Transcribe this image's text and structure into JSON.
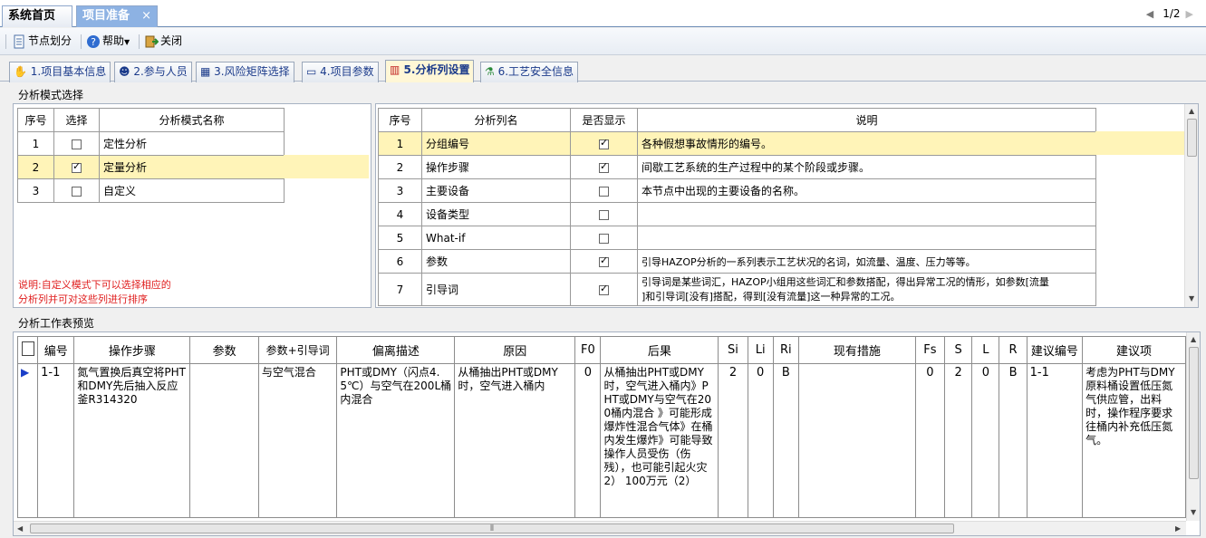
{
  "doc_tabs": {
    "home": "系统首页",
    "project": "项目准备",
    "close": "×"
  },
  "pager": {
    "text": "1/2",
    "prev": "◀",
    "next": "▶"
  },
  "toolbar": {
    "nodes": "节点划分",
    "help": "帮助",
    "close": "关闭"
  },
  "tabs": [
    "1.项目基本信息",
    "2.参与人员",
    "3.风险矩阵选择",
    "4.项目参数",
    "5.分析列设置",
    "6.工艺安全信息"
  ],
  "mode": {
    "section_title": "分析模式选择",
    "headers": [
      "序号",
      "选择",
      "分析模式名称"
    ],
    "rows": [
      {
        "no": "1",
        "checked": false,
        "name": "定性分析"
      },
      {
        "no": "2",
        "checked": true,
        "name": "定量分析"
      },
      {
        "no": "3",
        "checked": false,
        "name": "自定义"
      }
    ],
    "note_line1": "说明:自定义模式下可以选择相应的",
    "note_line2": "分析列并可对这些列进行排序"
  },
  "columns": {
    "headers": [
      "序号",
      "分析列名",
      "是否显示",
      "说明"
    ],
    "rows": [
      {
        "no": "1",
        "name": "分组编号",
        "show": true,
        "desc": "各种假想事故情形的编号。"
      },
      {
        "no": "2",
        "name": "操作步骤",
        "show": true,
        "desc": "间歇工艺系统的生产过程中的某个阶段或步骤。"
      },
      {
        "no": "3",
        "name": "主要设备",
        "show": false,
        "desc": "本节点中出现的主要设备的名称。"
      },
      {
        "no": "4",
        "name": "设备类型",
        "show": false,
        "desc": ""
      },
      {
        "no": "5",
        "name": "What-if",
        "show": false,
        "desc": ""
      },
      {
        "no": "6",
        "name": "参数",
        "show": true,
        "desc": "引导HAZOP分析的一系列表示工艺状况的名词，如流量、温度、压力等等。"
      },
      {
        "no": "7",
        "name": "引导词",
        "show": true,
        "desc": "引导词是某些词汇，HAZOP小组用这些词汇和参数搭配，得出异常工况的情形，如参数[流量"
      }
    ],
    "row7_desc_line2": "]和引导词[没有]搭配，得到[没有流量]这一种异常的工况。"
  },
  "worksheet": {
    "section_title": "分析工作表预览",
    "headers": [
      "编号",
      "操作步骤",
      "参数",
      "参数+引导词",
      "偏离描述",
      "原因",
      "F0",
      "后果",
      "Si",
      "Li",
      "Ri",
      "现有措施",
      "Fs",
      "S",
      "L",
      "R",
      "建议编号",
      "建议项"
    ],
    "row": {
      "id": "1-1",
      "step": "氮气置换后真空将PHT和DMY先后抽入反应釜R314320",
      "param": "",
      "param_guide": "与空气混合",
      "deviation": "PHT或DMY（闪点4.5℃）与空气在200L桶内混合",
      "cause": "从桶抽出PHT或DMY时，空气进入桶内",
      "f0": "0",
      "consequence": "从桶抽出PHT或DMY时，空气进入桶内》PHT或DMY与空气在200桶内混合 》可能形成爆炸性混合气体》在桶内发生爆炸》可能导致操作人员受伤（伤残），也可能引起火灾 2） 100万元（2）",
      "si": "2",
      "li": "0",
      "ri": "B",
      "measures": "",
      "fs": "0",
      "s": "2",
      "l": "0",
      "r": "B",
      "sugg_id": "1-1",
      "suggestion": "考虑为PHT与DMY原料桶设置低压氮气供应管，出料时，操作程序要求往桶内补充低压氮气。"
    }
  }
}
